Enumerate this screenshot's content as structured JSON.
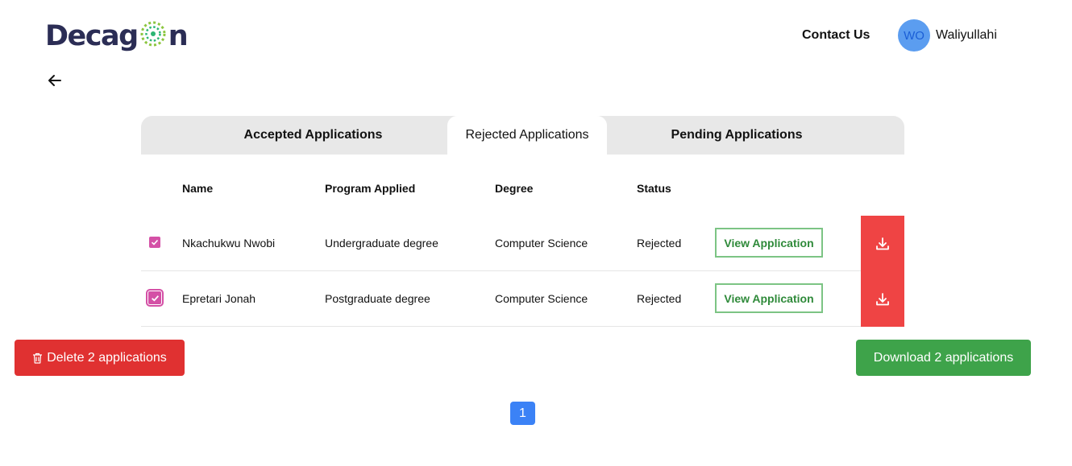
{
  "header": {
    "logo_prefix": "Decag",
    "logo_suffix": "n",
    "contact_label": "Contact Us",
    "avatar_initials": "WO",
    "username": "Waliyullahi"
  },
  "tabs": [
    {
      "label": "Accepted Applications",
      "active": false
    },
    {
      "label": "Rejected Applications",
      "active": true
    },
    {
      "label": "Pending Applications",
      "active": false
    }
  ],
  "table": {
    "columns": [
      "Name",
      "Program Applied",
      "Degree",
      "Status"
    ],
    "rows": [
      {
        "checked": true,
        "name": "Nkachukwu Nwobi",
        "program": "Undergraduate degree",
        "degree": "Computer Science",
        "status": "Rejected",
        "action_label": "View Application"
      },
      {
        "checked": true,
        "name": "Epretari Jonah",
        "program": "Postgraduate degree",
        "degree": "Computer Science",
        "status": "Rejected",
        "action_label": "View Application"
      }
    ]
  },
  "actions": {
    "delete_label": "Delete 2 applications",
    "download_label": "Download 2 applications"
  },
  "pagination": {
    "current_page": "1"
  },
  "icons": {
    "back": "arrow-left-icon",
    "download": "download-icon",
    "trash": "trash-icon",
    "check": "check-icon"
  },
  "colors": {
    "avatar_bg": "#5b9df0",
    "checkbox": "#d450a6",
    "view_border": "#7cc484",
    "download_row_bg": "#ef4444",
    "delete_bg": "#e03131",
    "download_all_bg": "#3ea34a",
    "page_active_bg": "#3b82f6"
  }
}
